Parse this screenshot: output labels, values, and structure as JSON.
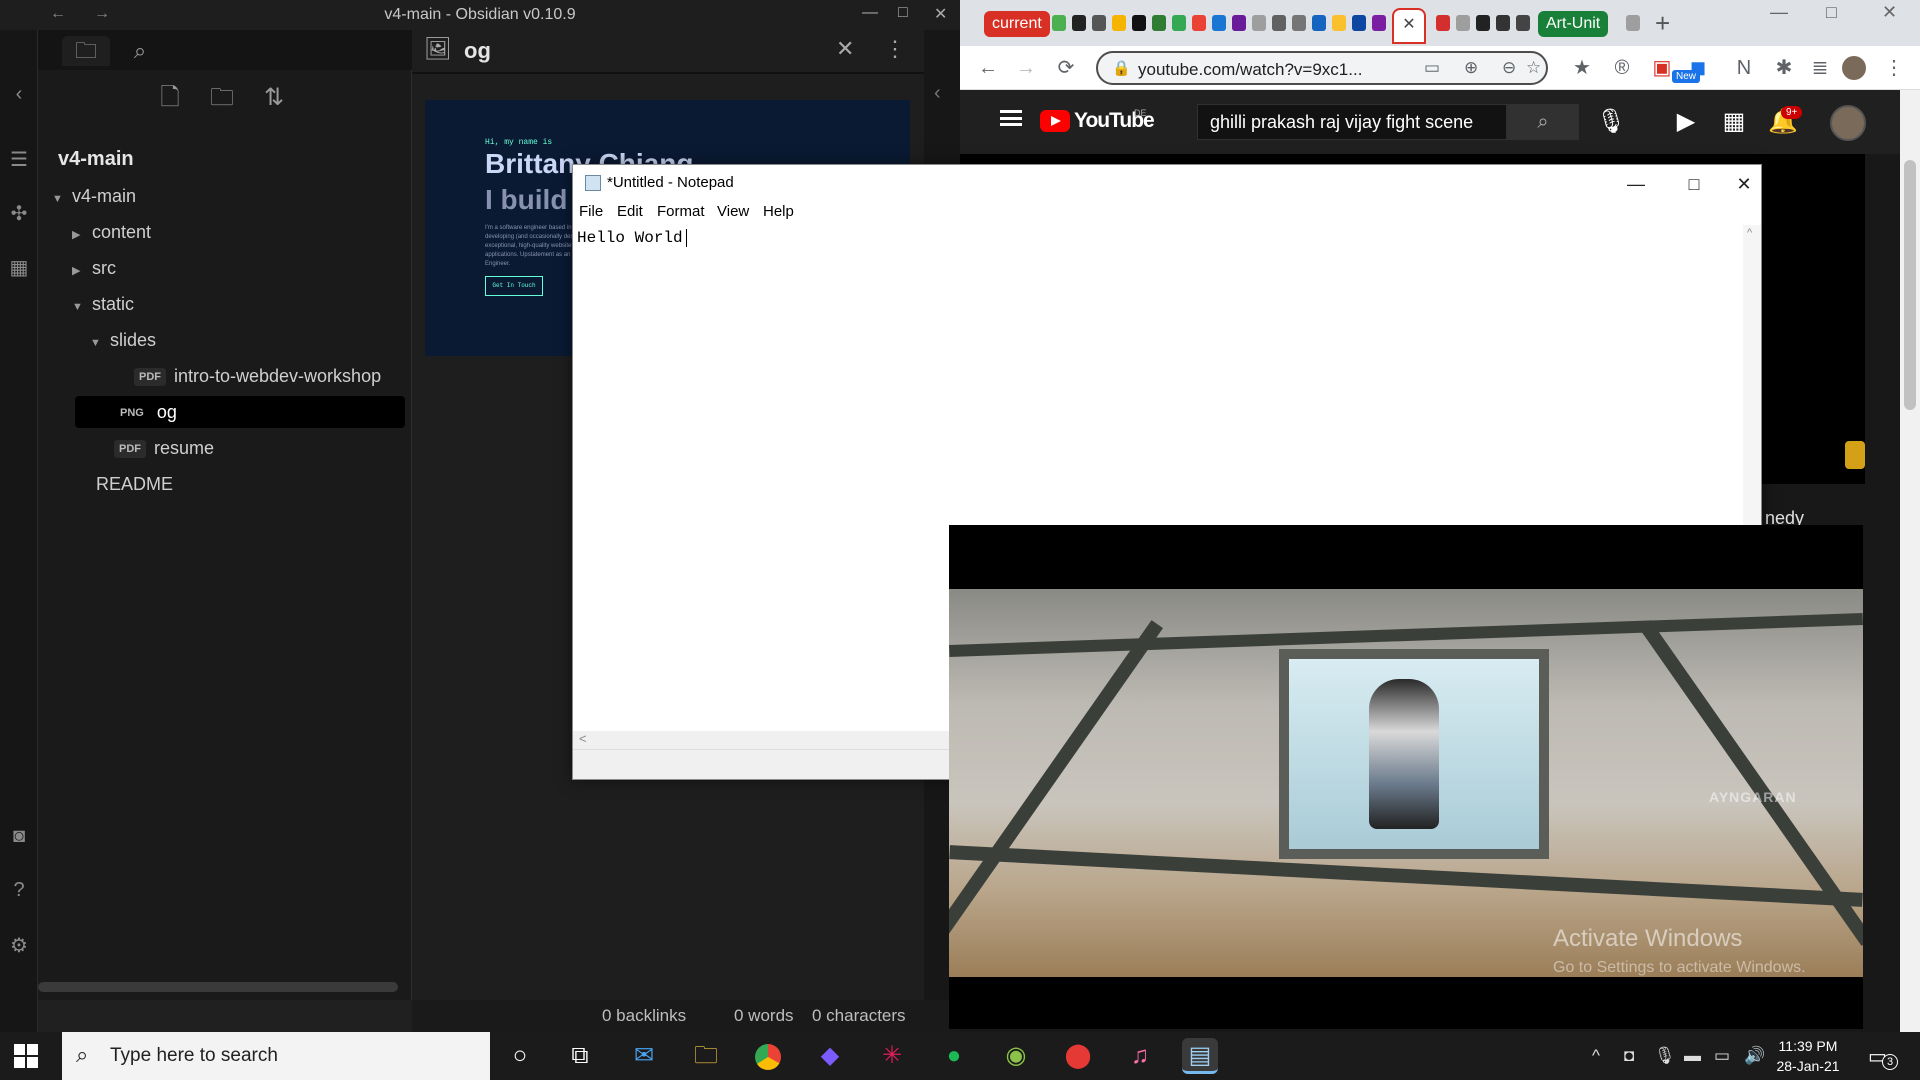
{
  "obsidian": {
    "window_title": "v4-main - Obsidian v0.10.9",
    "vault_name": "v4-main",
    "tree": [
      {
        "label": "v4-main",
        "type": "folder",
        "expanded": true
      },
      {
        "label": "content",
        "type": "folder",
        "expanded": false
      },
      {
        "label": "src",
        "type": "folder",
        "expanded": false
      },
      {
        "label": "static",
        "type": "folder",
        "expanded": true
      },
      {
        "label": "slides",
        "type": "folder",
        "expanded": true
      },
      {
        "label": "intro-to-webdev-workshop",
        "type": "file",
        "badge": "PDF"
      },
      {
        "label": "og",
        "type": "file",
        "badge": "PNG",
        "selected": true
      },
      {
        "label": "resume",
        "type": "file",
        "badge": "PDF"
      },
      {
        "label": "README",
        "type": "file"
      }
    ],
    "open_file": "og",
    "preview": {
      "greeting": "Hi, my name is",
      "name": "Brittany Chiang",
      "tagline": "I build",
      "blurb": "I'm a software engineer based in... developing (and occasionally designing) exceptional, high-quality websites and applications. Upstatement as an Engineer.",
      "cta": "Get In Touch"
    },
    "status": {
      "backlinks": "0 backlinks",
      "words": "0 words",
      "characters": "0 characters"
    }
  },
  "chrome": {
    "groups": [
      {
        "label": "current",
        "color": "#d93025"
      },
      {
        "label": "Art-Unit",
        "color": "#188038"
      }
    ],
    "url": "youtube.com/watch?v=9xc1...",
    "new_badge": "New"
  },
  "youtube": {
    "country": "DE",
    "wordmark": "YouTube",
    "search_query": "ghilli prakash raj vijay fight scene",
    "notification_count": "9+",
    "partial_text": "nedy"
  },
  "notepad": {
    "title": "*Untitled - Notepad",
    "menu": [
      "File",
      "Edit",
      "Format",
      "View",
      "Help"
    ],
    "content": "Hello World"
  },
  "video": {
    "watermark": "AYNGARAN",
    "activate_title": "Activate Windows",
    "activate_sub": "Go to Settings to activate Windows."
  },
  "taskbar": {
    "search_placeholder": "Type here to search",
    "time": "11:39 PM",
    "date": "28-Jan-21",
    "notification_count": "3"
  }
}
